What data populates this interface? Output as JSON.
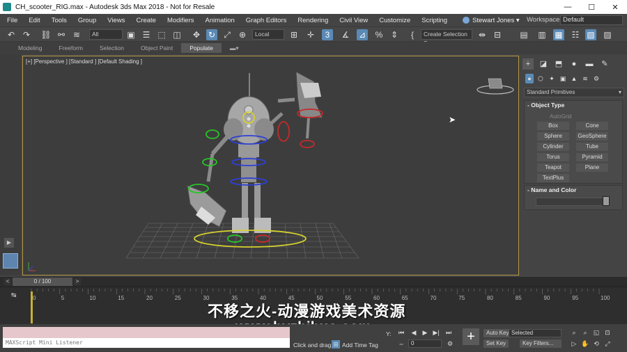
{
  "window": {
    "title": "CH_scooter_RIG.max - Autodesk 3ds Max 2018 - Not for Resale",
    "minimize": "—",
    "maximize": "☐",
    "close": "✕"
  },
  "menu": [
    "File",
    "Edit",
    "Tools",
    "Group",
    "Views",
    "Create",
    "Modifiers",
    "Animation",
    "Graph Editors",
    "Rendering",
    "Civil View",
    "Customize",
    "Scripting"
  ],
  "user": {
    "name": "Stewart Jones ▾"
  },
  "workspace": {
    "label": "Workspaces:",
    "value": "Default"
  },
  "toolbar": {
    "selection_filter": "All",
    "reference_coord": "Local",
    "named_selection": "Create Selection Se"
  },
  "ribbon_tabs": [
    "Modeling",
    "Freeform",
    "Selection",
    "Object Paint",
    "Populate"
  ],
  "ribbon_active": "Populate",
  "viewport": {
    "label": "[+] [Perspective ] [Standard ] [Default Shading ]",
    "grid_color": "#777777",
    "border_color": "#b79a45"
  },
  "command_panel": {
    "category": "Standard Primitives",
    "object_type_header": "Object Type",
    "autogrid": "AutoGrid",
    "buttons": [
      "Box",
      "Cone",
      "Sphere",
      "GeoSphere",
      "Cylinder",
      "Tube",
      "Torus",
      "Pyramid",
      "Teapot",
      "Plane",
      "TextPlus"
    ],
    "name_color_header": "Name and Color"
  },
  "timeline": {
    "frame_display": "0 / 100",
    "ticks": [
      "0",
      "5",
      "10",
      "15",
      "20",
      "25",
      "30",
      "35",
      "40",
      "45",
      "50",
      "55",
      "60",
      "65",
      "70",
      "75",
      "80",
      "85",
      "90",
      "95",
      "100"
    ]
  },
  "watermark": {
    "line1": "不移之火-动漫游戏美术资源",
    "line2": "www.byzhihuo.com"
  },
  "statusbar": {
    "listener_placeholder": "MAXScript Mini Listener",
    "prompt": "Click and drag",
    "add_time_tag": "Add Time Tag",
    "y_label": "Y:",
    "auto_key": "Auto Key",
    "set_key": "Set Key",
    "selected_value": "Selected",
    "key_filters": "Key Filters...",
    "frame_value": "0"
  }
}
